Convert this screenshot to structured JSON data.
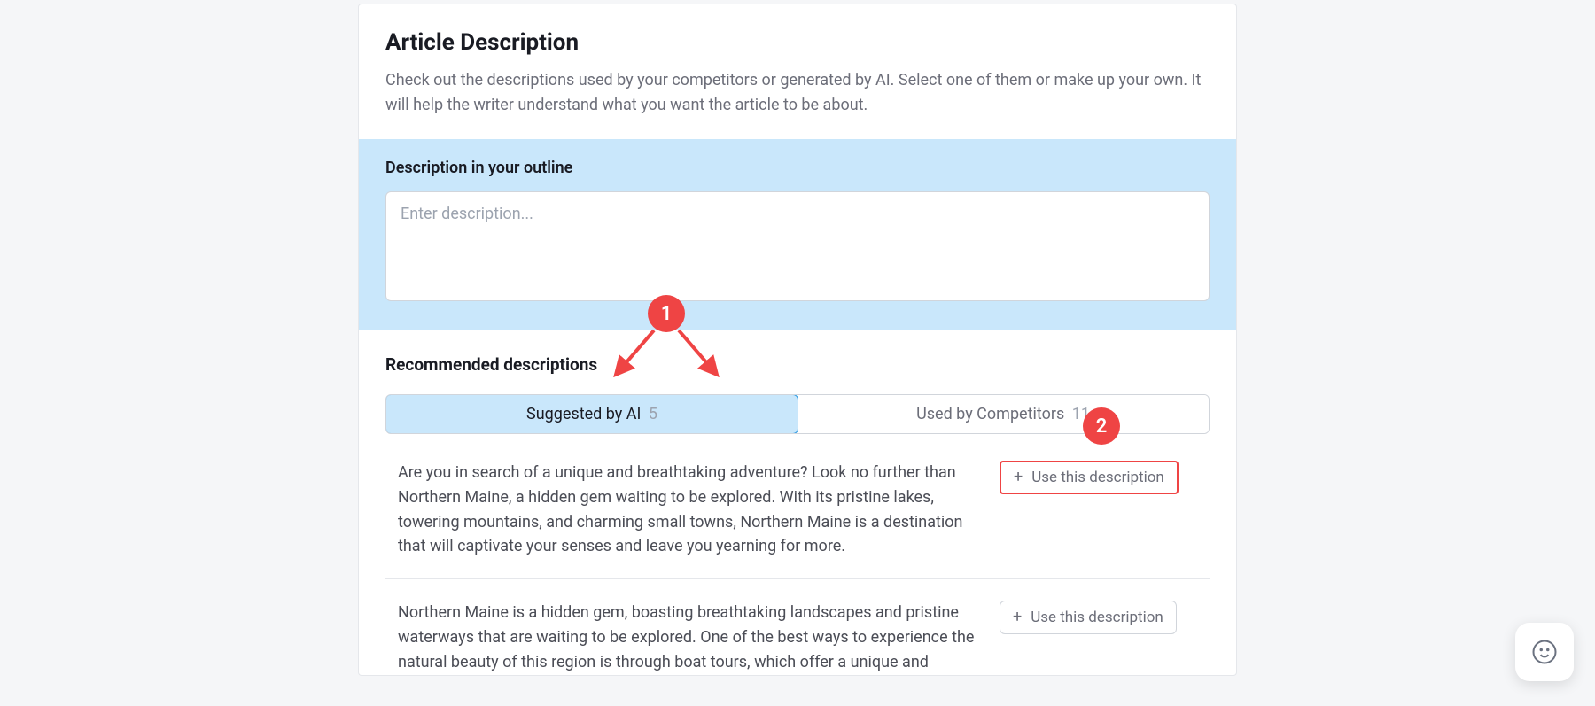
{
  "header": {
    "title": "Article Description",
    "subtitle": "Check out the descriptions used by your competitors or generated by AI. Select one of them or make up your own. It will help the writer understand what you want the article to be about."
  },
  "outline": {
    "label": "Description in your outline",
    "placeholder": "Enter description...",
    "value": ""
  },
  "recommended": {
    "heading": "Recommended descriptions",
    "tabs": {
      "ai": {
        "label": "Suggested by AI",
        "count": "5",
        "active": true
      },
      "competitors": {
        "label": "Used by Competitors",
        "count": "11",
        "active": false
      }
    },
    "use_button_label": "Use this description",
    "items": [
      {
        "text": "Are you in search of a unique and breathtaking adventure? Look no further than Northern Maine, a hidden gem waiting to be explored. With its pristine lakes, towering mountains, and charming small towns, Northern Maine is a destination that will captivate your senses and leave you yearning for more."
      },
      {
        "text": "Northern Maine is a hidden gem, boasting breathtaking landscapes and pristine waterways that are waiting to be explored. One of the best ways to experience the natural beauty of this region is through boat tours, which offer a unique and"
      }
    ]
  },
  "annotations": {
    "badge1": "1",
    "badge2": "2"
  }
}
